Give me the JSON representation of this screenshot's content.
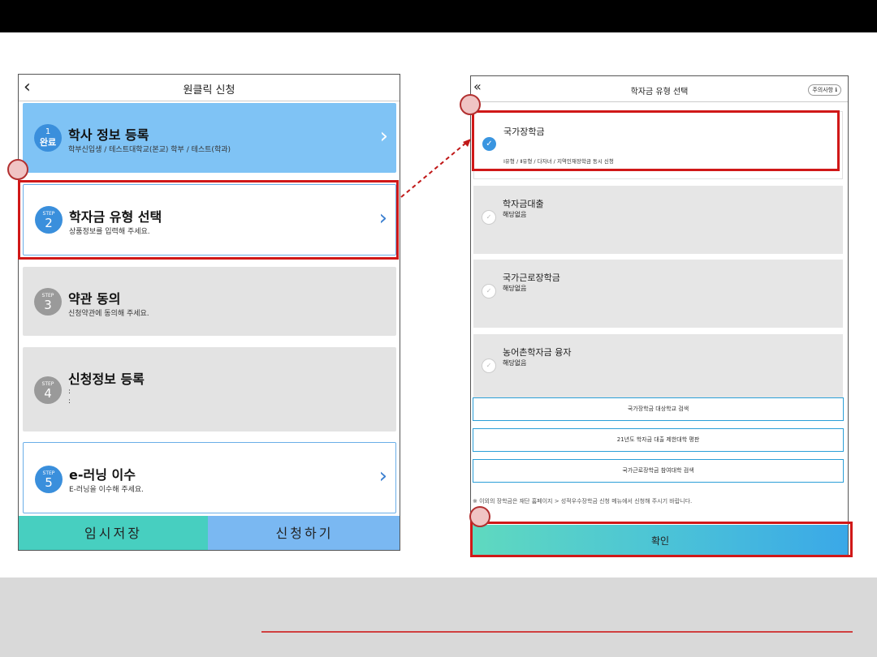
{
  "left_screen": {
    "back_icon": "chevron-left-icon",
    "title": "원클릭 신청",
    "steps": [
      {
        "badge_small": "1",
        "badge_main": "완료",
        "title": "학사 정보 등록",
        "sub": "학부신입생 / 테스트대학교(본교) 학부 / 테스트(학과)",
        "bg": "#7fc3f5"
      },
      {
        "badge_small": "STEP",
        "badge_main": "2",
        "title": "학자금 유형 선택",
        "sub": "상품정보를 입력해 주세요.",
        "bg": "#ffffff"
      },
      {
        "badge_small": "STEP",
        "badge_main": "3",
        "title": "약관 동의",
        "sub": "신청약관에 동의해 주세요.",
        "bg": "#e3e3e3"
      },
      {
        "badge_small": "STEP",
        "badge_main": "4",
        "title": "신청정보 등록",
        "sub": ":",
        "sub2": ":",
        "bg": "#e3e3e3"
      },
      {
        "badge_small": "STEP",
        "badge_main": "5",
        "title": "e-러닝 이수",
        "sub": "E-러닝을 이수해 주세요.",
        "bg": "#ffffff"
      }
    ],
    "save_button": "임시저장",
    "apply_button": "신청하기"
  },
  "right_screen": {
    "back_icon": "double-chevron-left-icon",
    "title": "학자금 유형 선택",
    "notice_badge": "주의사항 ℹ",
    "selected": {
      "name": "국가장학금",
      "desc": "Ⅰ유형 / Ⅱ유형 / 다자녀 / 지역인재장학금 동시 신청"
    },
    "options": [
      {
        "name": "학자금대출",
        "status": "해당없음"
      },
      {
        "name": "국가근로장학금",
        "status": "해당없음"
      },
      {
        "name": "농어촌학자금 융자",
        "status": "해당없음"
      }
    ],
    "links": [
      "국가장학금 대상학교 검색",
      "21년도 학자금 대출 제한대학 평판",
      "국가근로장학금 참여대학 검색"
    ],
    "note": "※ 이외의 장학금은 재단 홈페이지 > 성적우수장학금 신청 메뉴에서 신청해 주시기 바랍니다.",
    "confirm_button": "확인"
  },
  "colors": {
    "accent_red": "#d01818",
    "step_blue": "#3a8fdc",
    "teal": "#47cfc0"
  }
}
